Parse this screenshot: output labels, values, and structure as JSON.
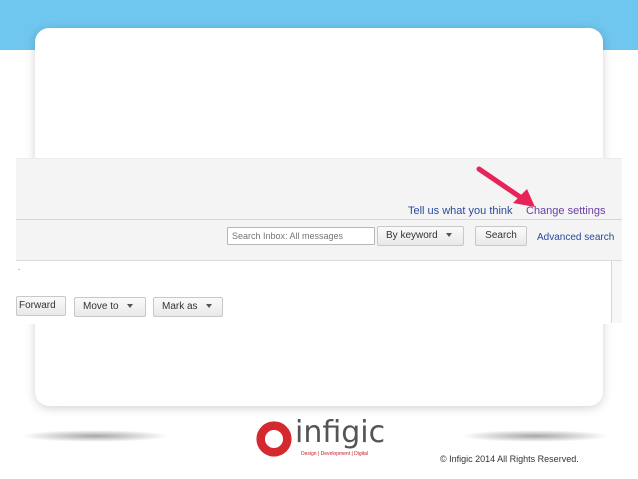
{
  "header": {
    "feedback_link": "Tell us what you think",
    "settings_link": "Change settings"
  },
  "search": {
    "placeholder": "Search Inbox: All messages",
    "keyword_button": "By keyword",
    "search_button": "Search",
    "advanced_link": "Advanced search"
  },
  "toolbar": {
    "forward_label": "Forward",
    "move_to_label": "Move to",
    "mark_as_label": "Mark as"
  },
  "annotation": {
    "arrow_color": "#e8235a"
  },
  "brand": {
    "logo_word": "infigic",
    "tagline": "Design | Development | Digital",
    "logo_color": "#d42a2f"
  },
  "footer": {
    "copyright": "© Infigic 2014  All Rights Reserved."
  },
  "colors": {
    "top_band": "#6fc6ee"
  }
}
